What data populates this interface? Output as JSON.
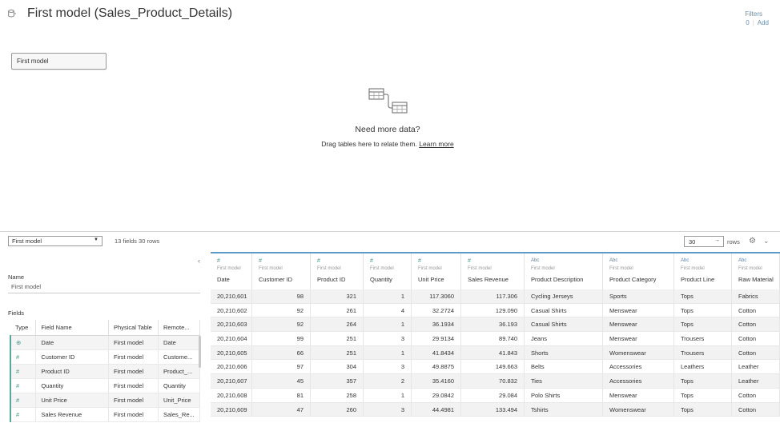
{
  "header": {
    "title": "First model (Sales_Product_Details)",
    "filters_label": "Filters",
    "filters_count": "0",
    "filters_add": "Add"
  },
  "canvas": {
    "table_chip": "First model",
    "need_more": "Need more data?",
    "drag_text": "Drag tables here to relate them.",
    "learn_more": "Learn more"
  },
  "toolbar": {
    "table_select": "First model",
    "fields_rows": "13 fields 30 rows",
    "rows_value": "30",
    "rows_label": "rows"
  },
  "left_panel": {
    "name_label": "Name",
    "name_value": "First model",
    "fields_label": "Fields",
    "columns": [
      "Type",
      "Field Name",
      "Physical Table",
      "Remote..."
    ],
    "rows": [
      {
        "type": "⊕",
        "field": "Date",
        "table": "First model",
        "remote": "Date"
      },
      {
        "type": "#",
        "field": "Customer ID",
        "table": "First model",
        "remote": "Custome..."
      },
      {
        "type": "#",
        "field": "Product ID",
        "table": "First model",
        "remote": "Product_..."
      },
      {
        "type": "#",
        "field": "Quantity",
        "table": "First model",
        "remote": "Quantity"
      },
      {
        "type": "#",
        "field": "Unit Price",
        "table": "First model",
        "remote": "Unit_Price"
      },
      {
        "type": "#",
        "field": "Sales Revenue",
        "table": "First model",
        "remote": "Sales_Re..."
      }
    ]
  },
  "grid": {
    "columns": [
      {
        "icon": "#",
        "source": "First model",
        "name": "Date",
        "align": "num"
      },
      {
        "icon": "#",
        "source": "First model",
        "name": "Customer ID",
        "align": "num"
      },
      {
        "icon": "#",
        "source": "First model",
        "name": "Product ID",
        "align": "num"
      },
      {
        "icon": "#",
        "source": "First model",
        "name": "Quantity",
        "align": "num"
      },
      {
        "icon": "#",
        "source": "First model",
        "name": "Unit Price",
        "align": "num"
      },
      {
        "icon": "#",
        "source": "First model",
        "name": "Sales Revenue",
        "align": "num"
      },
      {
        "icon": "Abc",
        "source": "First model",
        "name": "Product Description",
        "align": "txt"
      },
      {
        "icon": "Abc",
        "source": "First model",
        "name": "Product Category",
        "align": "txt"
      },
      {
        "icon": "Abc",
        "source": "First model",
        "name": "Product Line",
        "align": "txt"
      },
      {
        "icon": "Abc",
        "source": "First model",
        "name": "Raw Material",
        "align": "txt"
      }
    ],
    "rows": [
      [
        "20,210,601",
        "98",
        "321",
        "1",
        "117.3060",
        "117.306",
        "Cycling Jerseys",
        "Sports",
        "Tops",
        "Fabrics"
      ],
      [
        "20,210,602",
        "92",
        "261",
        "4",
        "32.2724",
        "129.090",
        "Casual Shirts",
        "Menswear",
        "Tops",
        "Cotton"
      ],
      [
        "20,210,603",
        "92",
        "264",
        "1",
        "36.1934",
        "36.193",
        "Casual Shirts",
        "Menswear",
        "Tops",
        "Cotton"
      ],
      [
        "20,210,604",
        "99",
        "251",
        "3",
        "29.9134",
        "89.740",
        "Jeans",
        "Menswear",
        "Trousers",
        "Cotton"
      ],
      [
        "20,210,605",
        "66",
        "251",
        "1",
        "41.8434",
        "41.843",
        "Shorts",
        "Womenswear",
        "Trousers",
        "Cotton"
      ],
      [
        "20,210,606",
        "97",
        "304",
        "3",
        "49.8875",
        "149.663",
        "Belts",
        "Accessories",
        "Leathers",
        "Leather"
      ],
      [
        "20,210,607",
        "45",
        "357",
        "2",
        "35.4160",
        "70.832",
        "Ties",
        "Accessories",
        "Tops",
        "Leather"
      ],
      [
        "20,210,608",
        "81",
        "258",
        "1",
        "29.0842",
        "29.084",
        "Polo Shirts",
        "Menswear",
        "Tops",
        "Cotton"
      ],
      [
        "20,210,609",
        "47",
        "260",
        "3",
        "44.4981",
        "133.494",
        "Tshirts",
        "Womenswear",
        "Tops",
        "Cotton"
      ]
    ]
  }
}
